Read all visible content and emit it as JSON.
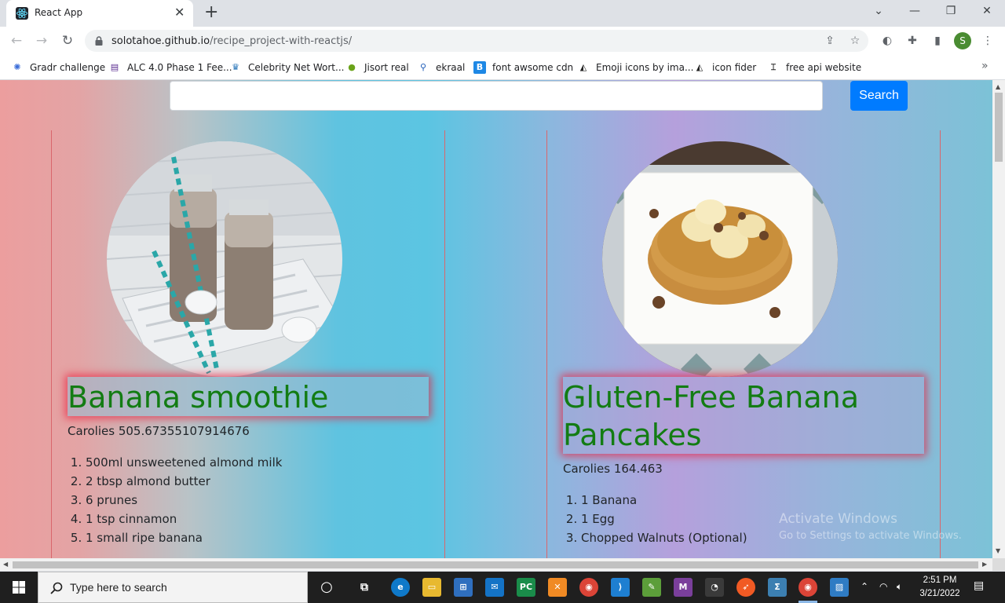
{
  "browser": {
    "tab_title": "React App",
    "url_host": "solotahoe.github.io",
    "url_path": "/recipe_project-with-reactjs/",
    "profile_initial": "S"
  },
  "bookmarks": [
    {
      "label": "Gradr challenge",
      "icon": "gradr-icon",
      "color": "#3d6fd9"
    },
    {
      "label": "ALC 4.0 Phase 1 Fee...",
      "icon": "alc-icon",
      "color": "#5b2d91"
    },
    {
      "label": "Celebrity Net Wort...",
      "icon": "crown-icon",
      "color": "#1f6fb5"
    },
    {
      "label": "Jisort real",
      "icon": "jisort-icon",
      "color": "#6aa319"
    },
    {
      "label": "ekraal",
      "icon": "ekraal-icon",
      "color": "#1c5bb8"
    },
    {
      "label": "font awsome cdn",
      "icon": "bootstrap-icon",
      "color": "#1e88e5"
    },
    {
      "label": "Emoji icons by ima...",
      "icon": "emoji-icon",
      "color": "#222222"
    },
    {
      "label": "icon fider",
      "icon": "iconfinder-icon",
      "color": "#222222"
    },
    {
      "label": "free api website",
      "icon": "api-icon",
      "color": "#222222"
    }
  ],
  "search": {
    "placeholder": "",
    "button_label": "Search"
  },
  "recipes": [
    {
      "title": "Banana smoothie",
      "calories": "Carolies 505.67355107914676",
      "ingredients": [
        "500ml unsweetened almond milk",
        "2 tbsp almond butter",
        "6 prunes",
        "1 tsp cinnamon",
        "1 small ripe banana"
      ]
    },
    {
      "title": "Gluten-Free Banana Pancakes",
      "calories": "Carolies 164.463",
      "ingredients": [
        "1 Banana",
        "1 Egg",
        "Chopped Walnuts (Optional)"
      ]
    }
  ],
  "watermark": {
    "line1": "Activate Windows",
    "line2": "Go to Settings to activate Windows."
  },
  "taskbar": {
    "search_placeholder": "Type here to search",
    "time": "2:51 PM",
    "date": "3/21/2022"
  }
}
